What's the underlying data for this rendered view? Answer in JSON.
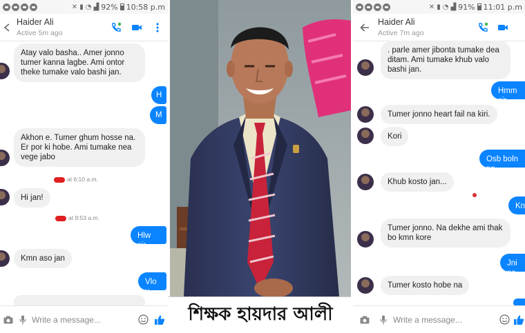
{
  "left_phone": {
    "status": {
      "battery": "92%",
      "time": "10:58 p.m"
    },
    "header": {
      "name": "Haider Ali",
      "status": "Active 5m ago"
    },
    "messages": {
      "m1": "Atay valo basha.. Amer jonno tumer kanna lagbe. Ami ontor theke tumake valo bashi jan.",
      "m2": "H",
      "m3": "M",
      "m4": "Akhon e. Tumer ghum hosse na. Er por ki hobe. Ami tumake nea vege jabo",
      "stamp1": "at 6:10 a.m.",
      "m5": "Hi jan!",
      "stamp2": "at 9:53 a.m.",
      "m6": "Hlw sir",
      "m7": "Kmn aso jan",
      "m8": "Vlo u"
    },
    "composer_placeholder": "Write a message..."
  },
  "photo": {
    "caption": "শিক্ষক হায়দার আলী"
  },
  "right_phone": {
    "status": {
      "battery": "91%",
      "time": "11:01 p.m"
    },
    "header": {
      "name": "Haider Ali",
      "status": "Active 7m ago"
    },
    "messages": {
      "m1": ". parle amer jibonta tumake dea ditam. Ami  tumake  khub valo bashi jan.",
      "m2": "Hmm sir",
      "m3": "Tumer jonno heart fail na kiri.",
      "m4": "Kori",
      "m5": "Osb boln na",
      "m6": "Khub kosto jan...",
      "m7": "Kno",
      "m8": "Tumer jonno. Na dekhe ami thak bo kmn kore",
      "m9": "Jni na",
      "m10": "Tumer  kosto hobe na"
    },
    "composer_placeholder": "Write a message..."
  },
  "colors": {
    "messenger_blue": "#0a84ff",
    "incoming_bubble": "#f0f0f0",
    "call_icon_green": "#3bb54a"
  }
}
